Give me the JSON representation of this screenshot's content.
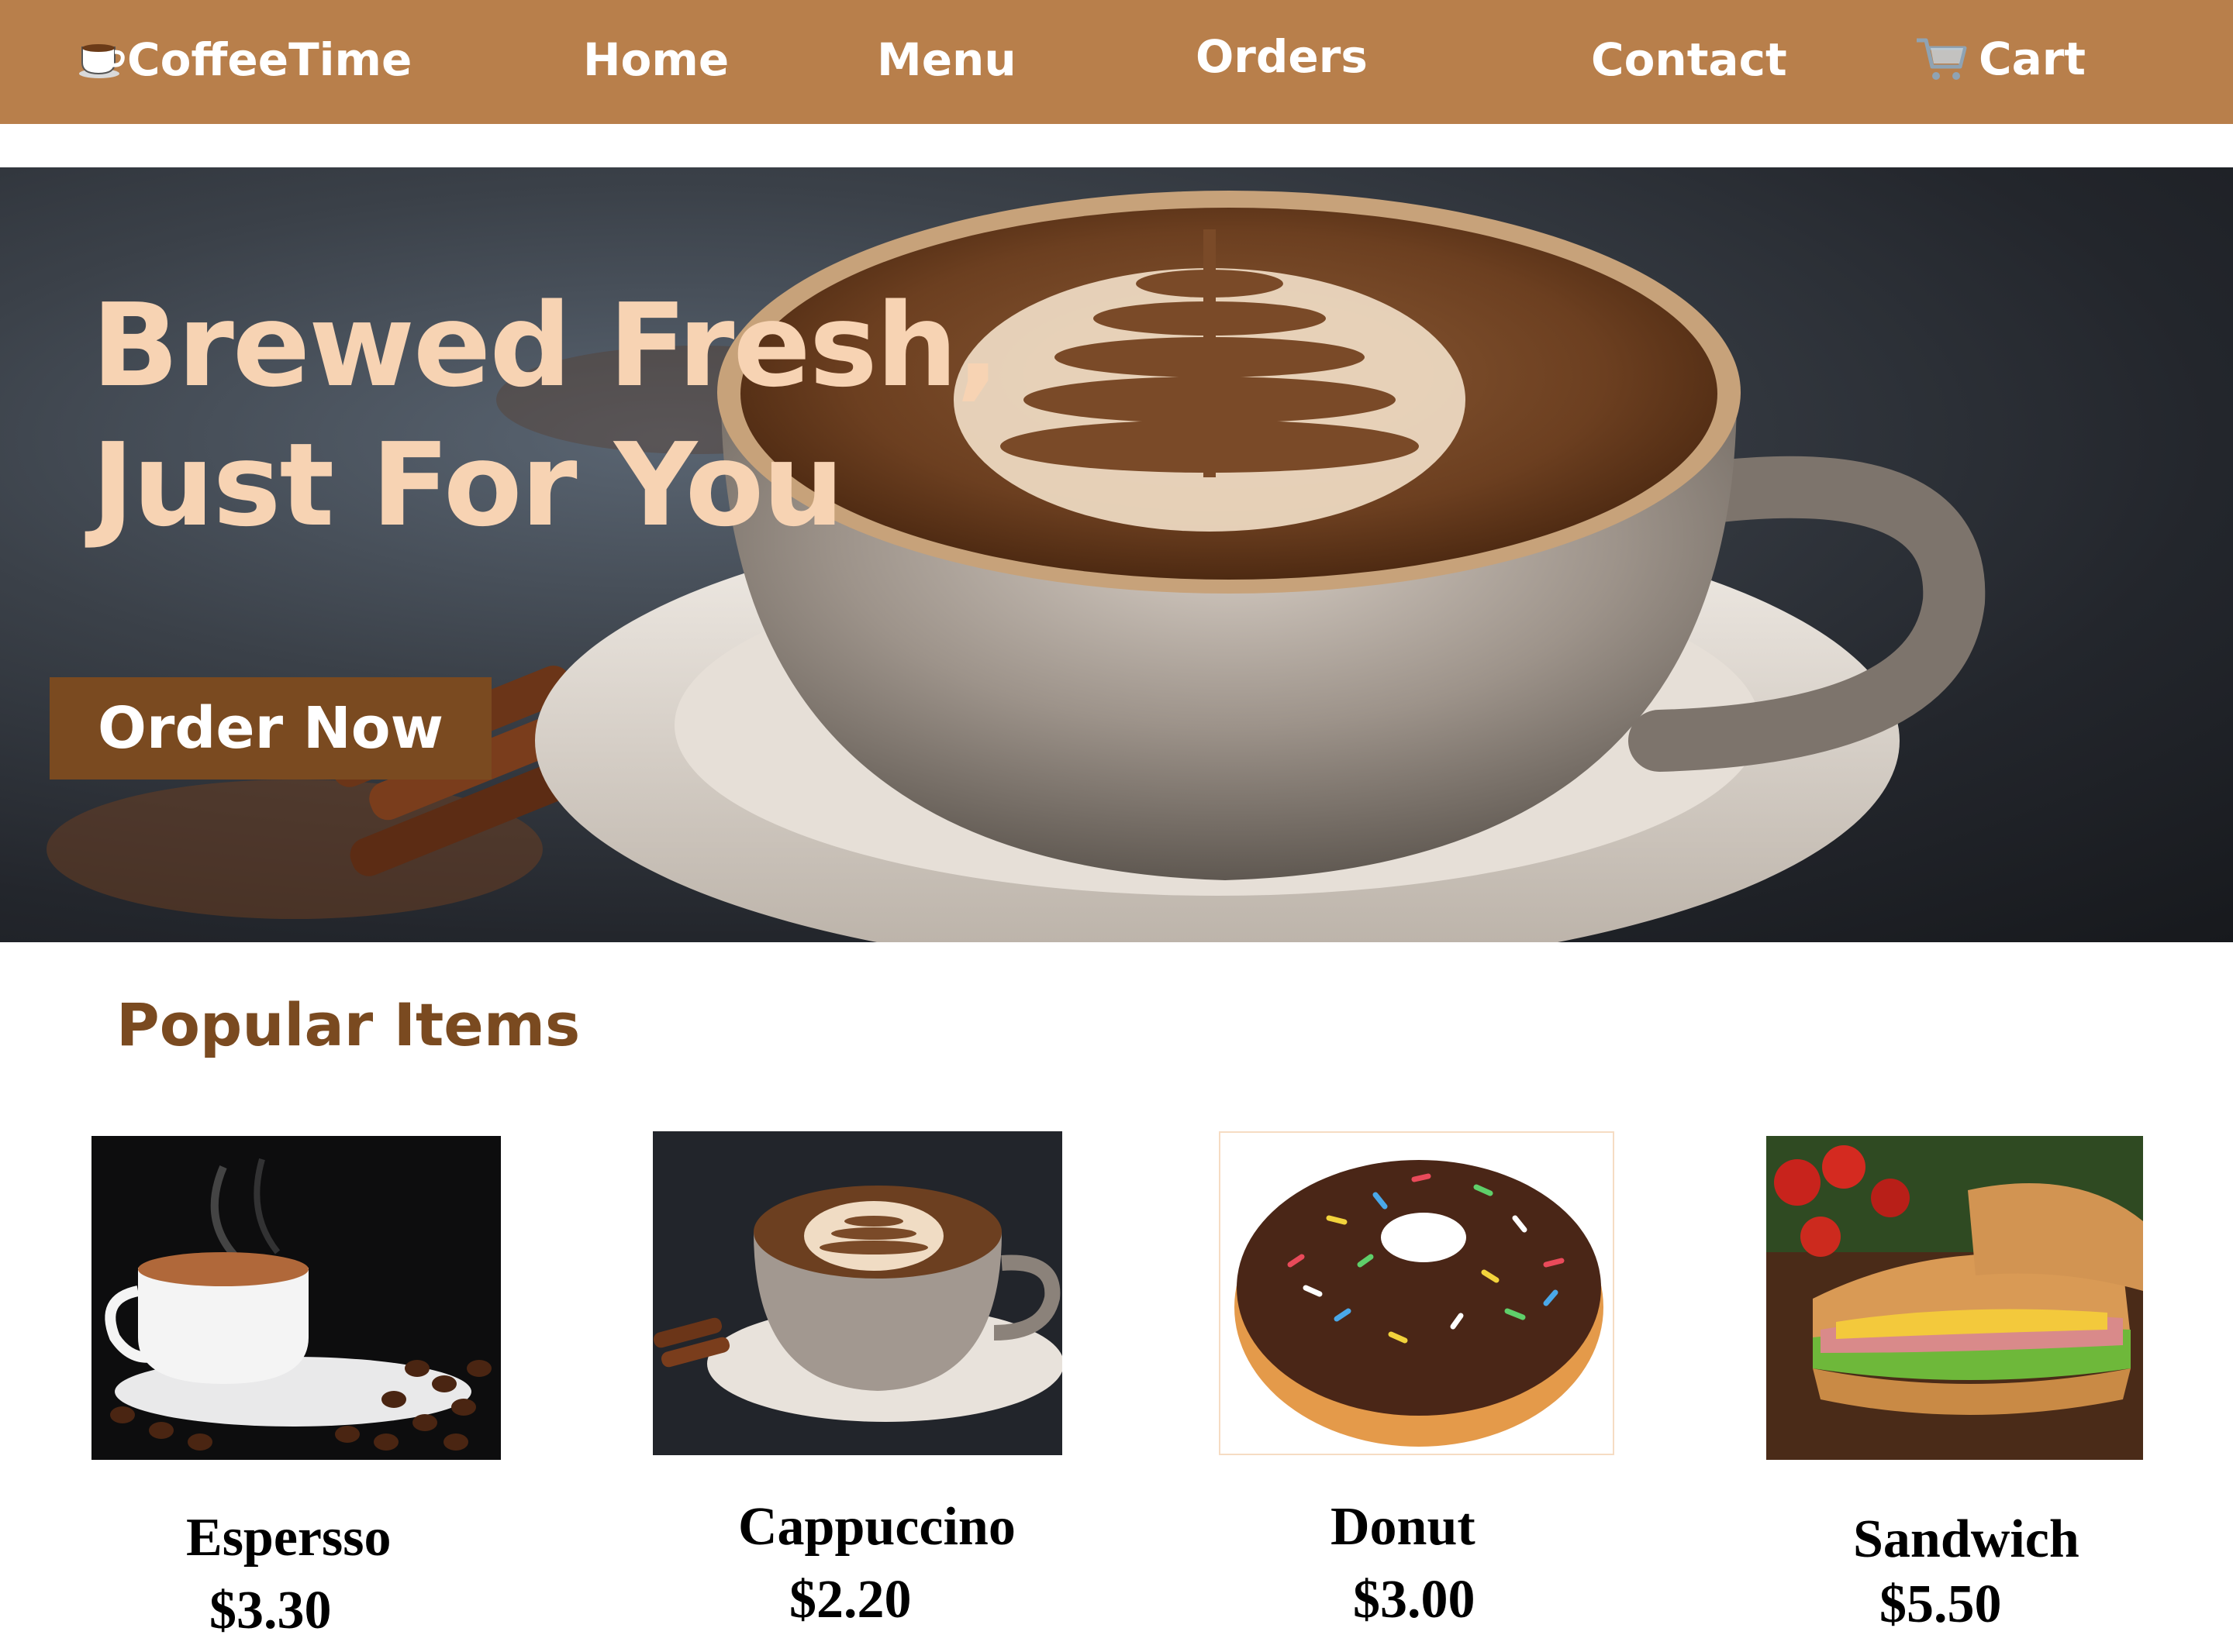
{
  "nav": {
    "brand": "CoffeeTime",
    "brand_icon": "coffee-cup-icon",
    "links": [
      "Home",
      "Menu",
      "Orders",
      "Contact"
    ],
    "cart_label": "Cart",
    "cart_icon": "shopping-cart-icon"
  },
  "hero": {
    "title_line1": "Brewed Fresh,",
    "title_line2": "Just For You",
    "cta": "Order Now"
  },
  "popular": {
    "title": "Popular Items",
    "items": [
      {
        "name": "Espersso",
        "price": "$3.30"
      },
      {
        "name": "Cappuccino",
        "price": "$2.20"
      },
      {
        "name": "Donut",
        "price": "$3.00"
      },
      {
        "name": "Sandwich",
        "price": "$5.50"
      }
    ]
  },
  "colors": {
    "nav_bg": "#b87f4b",
    "accent_brown": "#7a4a20",
    "hero_text": "#f7d3b3"
  }
}
